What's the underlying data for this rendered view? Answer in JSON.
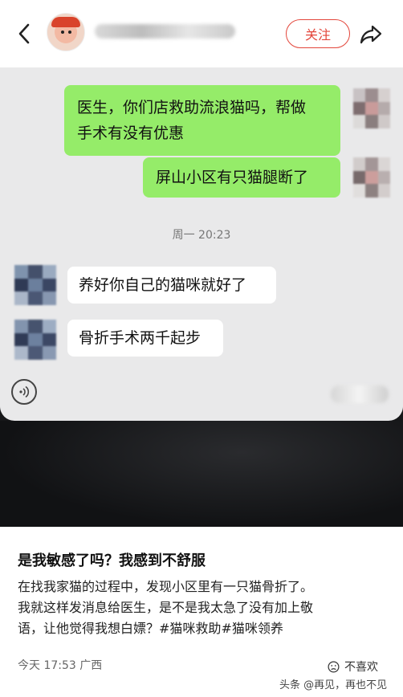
{
  "header": {
    "follow_label": "关注",
    "back_icon": "chevron-left-icon",
    "share_icon": "share-icon"
  },
  "chat": {
    "messages_right": [
      {
        "text_line1": "医生，你们店救助流浪猫吗，帮做",
        "text_line2": "手术有没有优惠"
      },
      {
        "text": "屏山小区有只猫腿断了"
      }
    ],
    "timestamp": "周一 20:23",
    "messages_left": [
      {
        "text": "养好你自己的猫咪就好了"
      },
      {
        "text": "骨折手术两千起步"
      }
    ],
    "colors": {
      "self_bubble": "#95ec69",
      "other_bubble": "#ffffff",
      "chat_bg": "#e9e9ea"
    }
  },
  "post": {
    "title": "是我敏感了吗？我感到不舒服",
    "body_line1": "在找我家猫的过程中，发现小区里有一只猫骨折了。",
    "body_line2": "我就这样发消息给医生，是不是我太急了没有加上敬",
    "body_line3_prefix": "语，让他觉得我想白嫖？",
    "tags": [
      "#猫咪救助",
      "#猫咪领养"
    ],
    "time": "今天 17:53",
    "location": "广西",
    "dislike_label": "不喜欢",
    "watermark": "头条 @再见，再也不见",
    "accent_color": "#e3463b"
  }
}
